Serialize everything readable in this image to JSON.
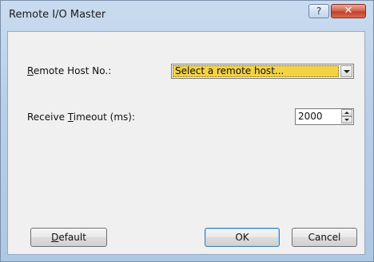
{
  "window": {
    "title": "Remote I/O Master",
    "help_glyph": "?",
    "close_glyph": "✕"
  },
  "remote_host": {
    "label_prefix": "",
    "label_mnemonic": "R",
    "label_rest": "emote Host No.:",
    "selected_value": "Select a remote host..."
  },
  "receive_timeout": {
    "label_prefix": "Receive ",
    "label_mnemonic": "T",
    "label_rest": "imeout (ms):",
    "value": "2000"
  },
  "buttons": {
    "default_mnemonic": "D",
    "default_rest": "efault",
    "ok": "OK",
    "cancel": "Cancel"
  },
  "colors": {
    "selection_highlight": "#f3d246",
    "close_button": "#c2412a"
  },
  "icons": {
    "help": "help-icon",
    "close": "close-icon",
    "dropdown": "chevron-down-icon",
    "spin_up": "spin-up-icon",
    "spin_down": "spin-down-icon"
  }
}
